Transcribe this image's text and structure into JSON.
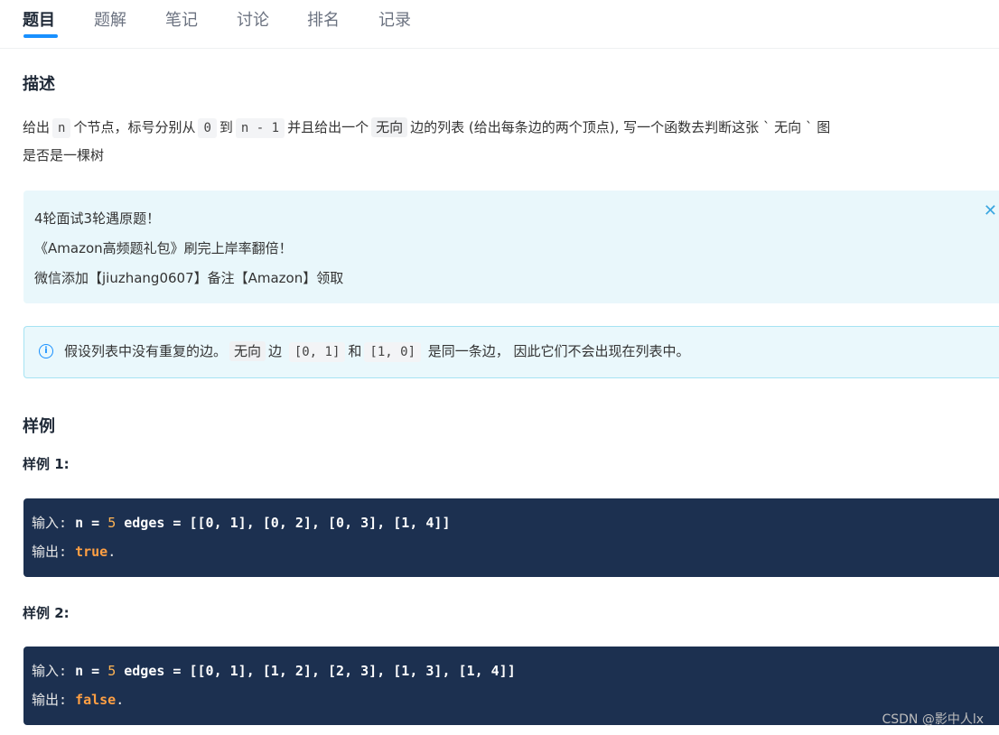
{
  "tabs": [
    {
      "label": "题目",
      "active": true
    },
    {
      "label": "题解"
    },
    {
      "label": "笔记"
    },
    {
      "label": "讨论"
    },
    {
      "label": "排名"
    },
    {
      "label": "记录"
    }
  ],
  "description": {
    "title": "描述",
    "parts": [
      "给出",
      "n",
      "个节点，标号分别从",
      "0",
      "到",
      "n - 1",
      "并且给出一个",
      "无向",
      "边的列表 (给出每条边的两个顶点), 写一个函数去判断这张 ` 无向 ` 图",
      "是否是一棵树"
    ]
  },
  "promo": {
    "lines": [
      "4轮面试3轮遇原题！",
      "《Amazon高频题礼包》刷完上岸率翻倍！",
      "微信添加【jiuzhang0607】备注【Amazon】领取"
    ],
    "close_icon": "close-icon"
  },
  "note": {
    "icon": "info-icon",
    "parts": [
      "假设列表中没有重复的边。",
      "无向",
      "边",
      "[0, 1]",
      "和",
      "[1, 0]",
      "是同一条边， 因此它们不会出现在列表中。"
    ]
  },
  "examples": {
    "title": "样例",
    "items": [
      {
        "title": "样例 1:",
        "input_label": "输入:",
        "n_text": "n = ",
        "n_value": "5",
        "edges_text": " edges = [[0, 1], [0, 2], [0, 3], [1, 4]]",
        "output_label": "输出:",
        "output_value": "true",
        "output_end": "."
      },
      {
        "title": "样例 2:",
        "input_label": "输入:",
        "n_text": "n = ",
        "n_value": "5",
        "edges_text": " edges = [[0, 1], [1, 2], [2, 3], [1, 3], [1, 4]]",
        "output_label": "输出:",
        "output_value": "false",
        "output_end": "."
      }
    ]
  },
  "watermark": "CSDN @影中人lx",
  "colors": {
    "accent": "#1890ff",
    "code_bg": "#1c3050",
    "promo_bg": "#e9f7fb",
    "note_border": "#a6e3f3"
  }
}
